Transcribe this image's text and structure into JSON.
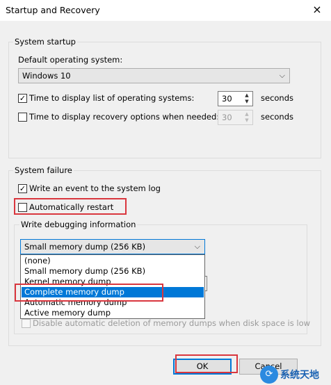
{
  "window": {
    "title": "Startup and Recovery",
    "close_glyph": "×"
  },
  "system_startup": {
    "legend": "System startup",
    "default_os_label": "Default operating system:",
    "default_os_value": "Windows 10",
    "time_list_label": "Time to display list of operating systems:",
    "time_list_checked": true,
    "time_list_value": "30",
    "time_recovery_label": "Time to display recovery options when needed:",
    "time_recovery_checked": false,
    "time_recovery_value": "30",
    "seconds": "seconds"
  },
  "system_failure": {
    "legend": "System failure",
    "write_event_label": "Write an event to the system log",
    "write_event_checked": true,
    "auto_restart_label": "Automatically restart",
    "auto_restart_checked": false,
    "debug_legend": "Write debugging information",
    "debug_selected": "Small memory dump (256 KB)",
    "debug_options": [
      "(none)",
      "Small memory dump (256 KB)",
      "Kernel memory dump",
      "Complete memory dump",
      "Automatic memory dump",
      "Active memory dump"
    ],
    "highlighted_option": "Complete memory dump",
    "disable_auto_delete_label": "Disable automatic deletion of memory dumps when disk space is low"
  },
  "buttons": {
    "ok": "OK",
    "cancel": "Cancel"
  },
  "watermark": {
    "text": "系统天地"
  },
  "colors": {
    "highlight": "#0078d7",
    "annotation_red": "#d9363e"
  },
  "icons": {
    "check": "✓",
    "chevron_down": "⌵",
    "spin_up": "▲",
    "spin_down": "▼"
  }
}
